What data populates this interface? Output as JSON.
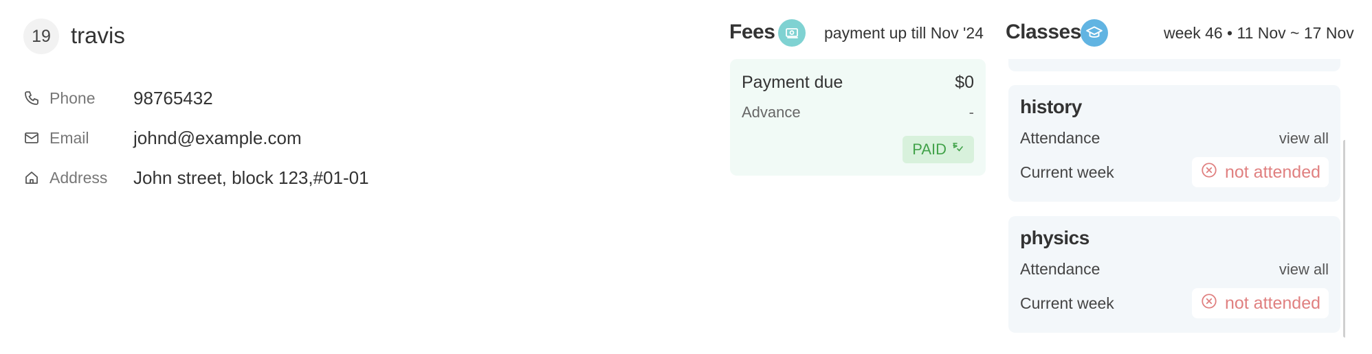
{
  "profile": {
    "number": "19",
    "name": "travis",
    "fields": [
      {
        "icon": "phone-icon",
        "label": "Phone",
        "value": "98765432"
      },
      {
        "icon": "mail-icon",
        "label": "Email",
        "value": "johnd@example.com"
      },
      {
        "icon": "home-icon",
        "label": "Address",
        "value": "John street, block 123,#01-01"
      }
    ]
  },
  "fees": {
    "title": "Fees",
    "icon": "money-icon",
    "subtitle": "payment up till Nov '24",
    "payment_due_label": "Payment due",
    "payment_due_value": "$0",
    "advance_label": "Advance",
    "advance_value": "-",
    "status": "PAID",
    "status_icon": "paid-check-icon",
    "colors": {
      "card_bg": "#f1faf6",
      "badge_bg": "#d8f1dc",
      "badge_text": "#41a249"
    }
  },
  "classes": {
    "title": "Classes",
    "icon": "graduation-cap-icon",
    "week_label": "week 46 • 11 Nov ~ 17 Nov",
    "items": [
      {
        "name": "history",
        "attendance_label": "Attendance",
        "view_all": "view all",
        "current_week_label": "Current week",
        "status": "not attended"
      },
      {
        "name": "physics",
        "attendance_label": "Attendance",
        "view_all": "view all",
        "current_week_label": "Current week",
        "status": "not attended"
      }
    ],
    "colors": {
      "card_bg": "#f3f7fa",
      "status_text": "#e08080"
    }
  }
}
